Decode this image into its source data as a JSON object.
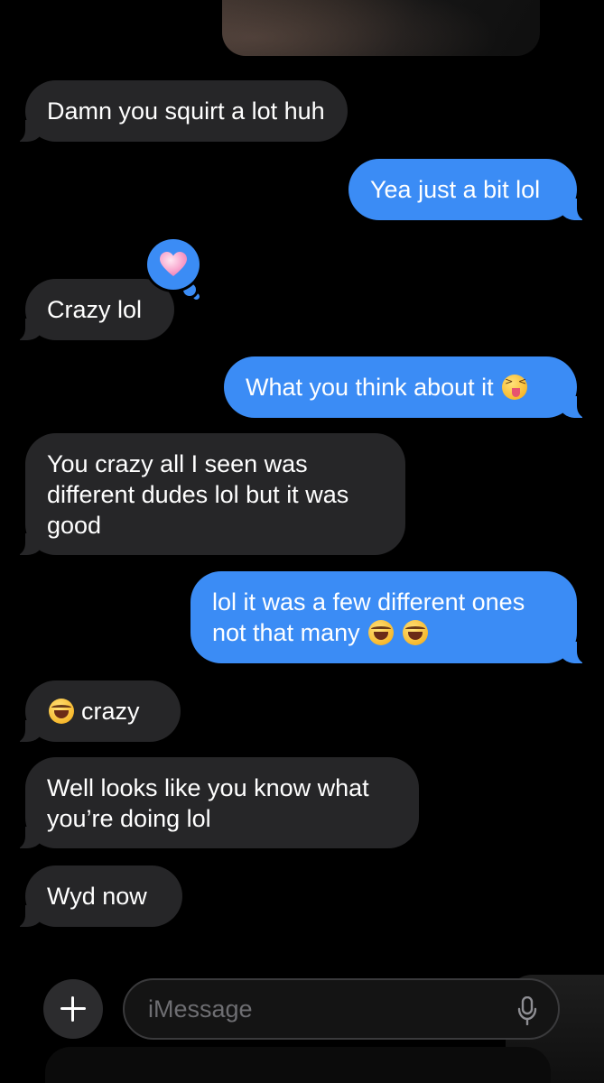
{
  "conversation": {
    "messages": [
      {
        "id": "m1",
        "direction": "incoming",
        "text": "Damn you squirt a lot huh"
      },
      {
        "id": "m2",
        "direction": "outgoing",
        "text": "Yea just a bit lol"
      },
      {
        "id": "m3",
        "direction": "incoming",
        "text": "Crazy lol",
        "reaction": "heart"
      },
      {
        "id": "m4",
        "direction": "outgoing",
        "text": "What you think about it",
        "emoji": [
          "squinting-face-with-tongue"
        ]
      },
      {
        "id": "m5",
        "direction": "incoming",
        "text": "You crazy all I seen was different dudes lol but it was good"
      },
      {
        "id": "m6",
        "direction": "outgoing",
        "text": "lol it was a few different ones not that many",
        "emoji": [
          "face-with-tears-of-joy",
          "face-with-tears-of-joy"
        ]
      },
      {
        "id": "m7",
        "direction": "incoming",
        "text": "crazy",
        "emoji_prefix": [
          "face-with-tears-of-joy"
        ]
      },
      {
        "id": "m8",
        "direction": "incoming",
        "text": "Well looks like you know what you’re doing lol"
      },
      {
        "id": "m9",
        "direction": "incoming",
        "text": "Wyd now"
      }
    ]
  },
  "composer": {
    "placeholder": "iMessage",
    "plus_icon": "plus-icon",
    "mic_icon": "microphone-icon"
  },
  "colors": {
    "outgoing_bubble": "#3b8cf5",
    "incoming_bubble": "#262628",
    "background": "#000000",
    "placeholder_text": "#6e6e72"
  }
}
